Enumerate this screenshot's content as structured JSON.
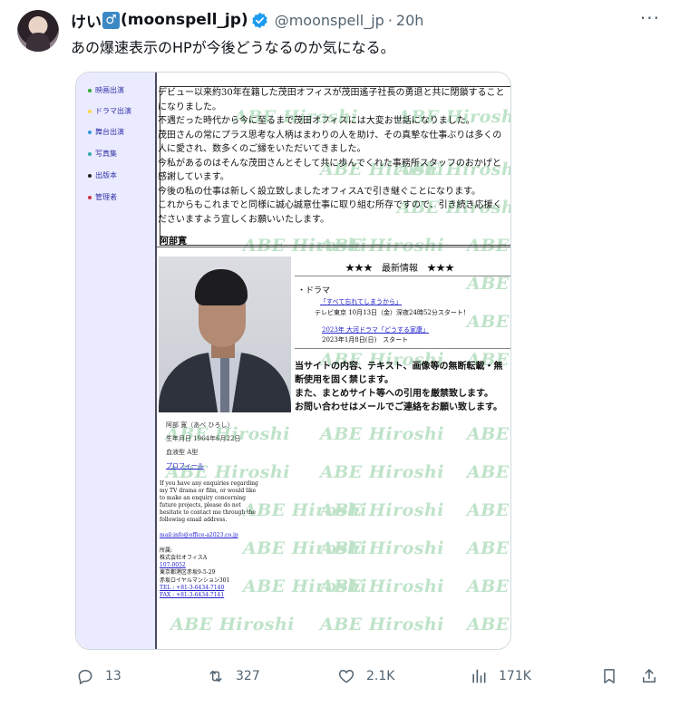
{
  "author": {
    "display_name": "けい",
    "name_suffix": "(moonspell_jp)",
    "handle": "@moonspell_jp",
    "separator": "·",
    "time": "20h",
    "badge_glyph": "♂"
  },
  "more_glyph": "···",
  "tweet_text": "あの爆速表示のHPが今後どうなるのか気になる。",
  "site": {
    "menu": [
      {
        "label": "映画出演",
        "dot_color": "#33aa33"
      },
      {
        "label": "ドラマ出演",
        "dot_color": "#ffd84a"
      },
      {
        "label": "舞台出演",
        "dot_color": "#3399dd"
      },
      {
        "label": "写真集",
        "dot_color": "#33aaaa"
      },
      {
        "label": "出版本",
        "dot_color": "#222222"
      },
      {
        "label": "管理者",
        "dot_color": "#cc3344"
      }
    ],
    "watermark": "ABE Hiroshi",
    "top_text": [
      "デビュー以来約30年在籍した茂田オフィスが茂田遙子社長の勇退と共に閉鎖すること",
      "になりました。",
      "不遇だった時代から今に至るまで茂田オフィスには大変お世話になりました。",
      "茂田さんの常にプラス思考な人柄はまわりの人を助け、その真摯な仕事ぶりは多くの",
      "人に愛され、数多くのご縁をいただいてきました。",
      "今私があるのはそんな茂田さんとそして共に歩んでくれた事務所スタッフのおかげと",
      "感謝しています。",
      "今後の私の仕事は新しく設立致しましたオフィスAで引き継ぐことになります。",
      "これからもこれまでと同様に誠心誠意仕事に取り組む所存ですので、引き続き応援く",
      "ださいますよう宜しくお願いいたします。"
    ],
    "signature": "阿部寛",
    "news_heading": "★★★　最新情報　★★★",
    "news_sub": "・ドラマ",
    "news_link1": "「すべて忘れてしまうから」",
    "news_text1": "テレビ東京 10月13日（金）深夜24時52分スタート！",
    "news_link2": "2023年 大河ドラマ「どうする家康」",
    "news_text2": "2023年1月8日(日)　スタート",
    "notice": [
      "当サイトの内容、テキスト、画像等の無断転載・無",
      "断使用を固く禁じます。",
      "また、まとめサイト等への引用を厳禁致します。",
      "お問い合わせはメールでご連絡をお願い致します。"
    ],
    "profile": [
      "阿部 寛（あべ ひろし）",
      "生年月日 1964年6月22日",
      "血液型 A型"
    ],
    "profile_link": "プロフィール",
    "english_note": "If you have any enquiries regarding my TV drama or film, or would like to make an enquiry concerning future projects, please do not hesitate to contact me through the following email address.",
    "mail": "mail:info@office-a2023.co.jp",
    "office_label": "所属:",
    "office_name": "株式会社オフィスA",
    "postal": "107-0052",
    "address1": "東京都港区赤坂9-5-29",
    "address2": "赤坂ロイヤルマンション301",
    "tel": "TEL : +81-3-6434-7140",
    "fax": "FAX : +81-3-6434-7141"
  },
  "actions": {
    "replies": "13",
    "retweets": "327",
    "likes": "2.1K",
    "views": "171K"
  }
}
